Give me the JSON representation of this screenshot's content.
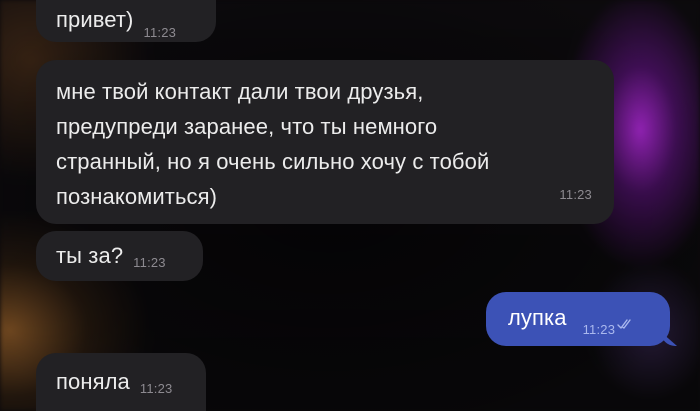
{
  "colors": {
    "incoming_bubble": "#222124",
    "outgoing_bubble": "#3c52b6",
    "background": "#0b0a0c",
    "accent_glow": "#aa28d2"
  },
  "messages": [
    {
      "direction": "incoming",
      "text": "привет)",
      "time": "11:23"
    },
    {
      "direction": "incoming",
      "lines": [
        "мне твой контакт дали твои друзья,",
        "предупреди заранее, что ты немного",
        "странный, но я очень сильно хочу с тобой",
        "познакомиться)"
      ],
      "time": "11:23"
    },
    {
      "direction": "incoming",
      "text": "ты за?",
      "time": "11:23"
    },
    {
      "direction": "outgoing",
      "text": "лупка",
      "time": "11:23",
      "status_icon": "double-check-icon"
    },
    {
      "direction": "incoming",
      "text": "поняла",
      "time": "11:23"
    }
  ]
}
